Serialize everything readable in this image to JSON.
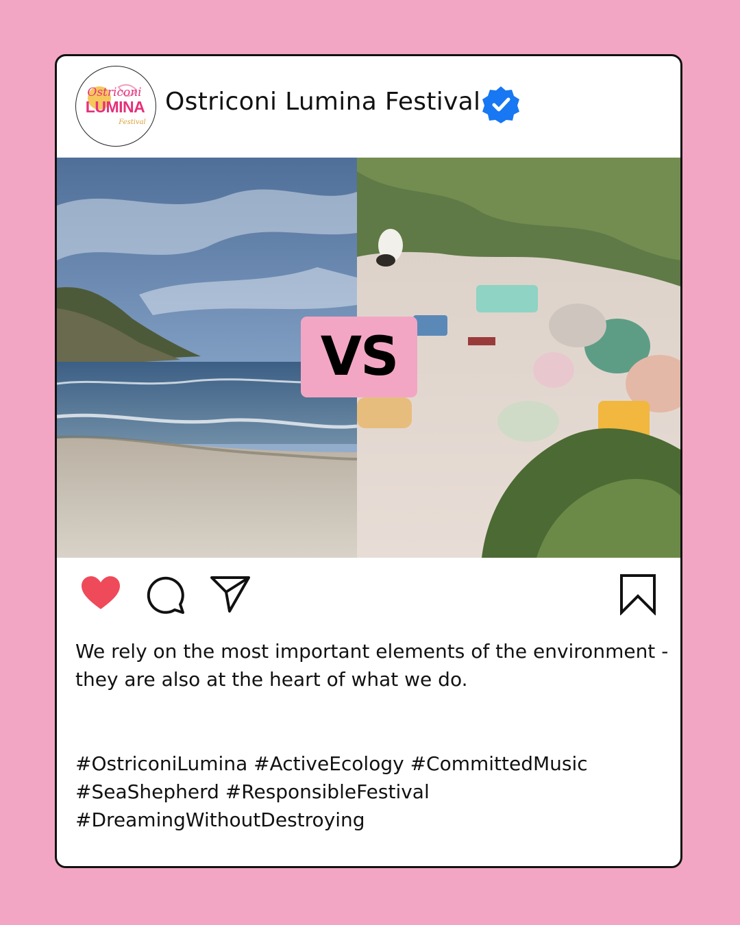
{
  "post": {
    "account": {
      "name": "Ostriconi Lumina Festival",
      "verified": true,
      "logo_text": {
        "line1": "Ostriconi",
        "line2": "LUMINA",
        "line3": "Festival"
      }
    },
    "image": {
      "left_scene": "clean-beach-photo",
      "right_scene": "polluted-beach-photo",
      "overlay_label": "VS"
    },
    "actions": {
      "like": {
        "icon": "heart-icon",
        "liked": true
      },
      "comment": {
        "icon": "comment-icon"
      },
      "share": {
        "icon": "send-icon"
      },
      "save": {
        "icon": "bookmark-icon"
      }
    },
    "caption": {
      "line1": "We rely on the most important elements of the environment -",
      "line2": "they are also at the heart of what we do."
    },
    "hashtags": {
      "line1": "#OstriconiLumina #ActiveEcology #CommittedMusic",
      "line2": "#SeaShepherd #ResponsibleFestival",
      "line3": "#DreamingWithoutDestroying"
    }
  },
  "colors": {
    "background": "#f3a6c3",
    "badge": "#f3a6c3",
    "like": "#ef4a5a",
    "verified": "#1877f2",
    "logo_magenta": "#e6307a",
    "logo_yellow": "#f2c24a"
  }
}
